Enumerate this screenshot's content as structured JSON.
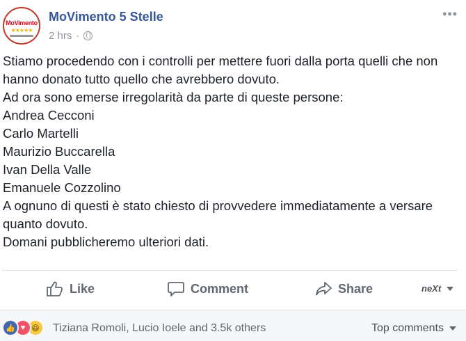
{
  "header": {
    "avatar_text": "MoVimento",
    "avatar_stars": "★★★★★",
    "page_name": "MoVimento 5 Stelle",
    "time": "2 hrs",
    "privacy_icon": "globe-icon",
    "more_icon": "more-options-icon"
  },
  "post": {
    "lines": [
      "Stiamo procedendo con i controlli per mettere fuori dalla porta quelli che non",
      "hanno donato tutto quello che avrebbero dovuto.",
      "Ad ora sono emerse irregolarità da parte di queste persone:",
      "Andrea Cecconi",
      "Carlo Martelli",
      "Maurizio Buccarella",
      "Ivan Della Valle",
      "Emanuele Cozzolino",
      "A ognuno di questi è stato chiesto di provvedere immediatamente a versare",
      "quanto dovuto.",
      "Domani pubblicheremo ulteriori dati."
    ]
  },
  "actions": {
    "like_label": "Like",
    "comment_label": "Comment",
    "share_label": "Share",
    "next_label": "neXt"
  },
  "footer": {
    "reactors": "Tiziana Romoli, Lucio Ioele and 3.5k others",
    "sort_label": "Top comments"
  },
  "colors": {
    "link": "#365899",
    "meta": "#90949c",
    "action": "#606770",
    "like": "#4267b2",
    "love": "#f25268",
    "haha": "#f7c842"
  }
}
